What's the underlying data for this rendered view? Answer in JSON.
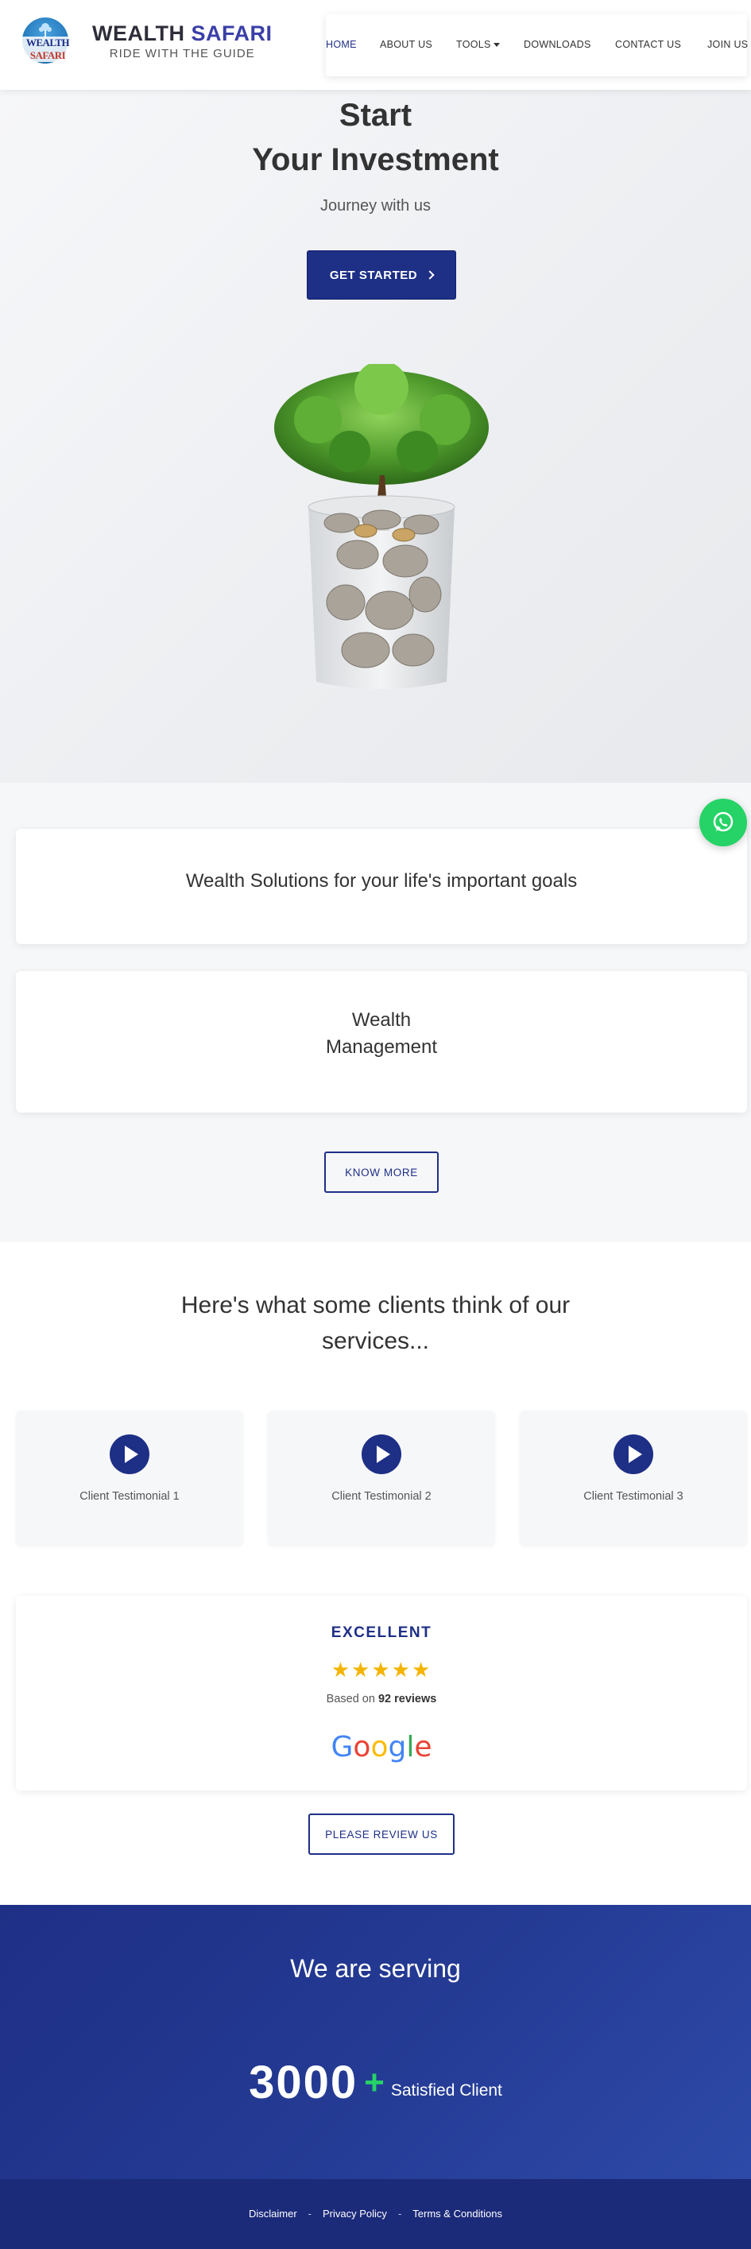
{
  "header": {
    "logo_wordmark_a": "WEALTH",
    "logo_wordmark_b": "SAFARI",
    "brand_name_a": "WEALTH",
    "brand_name_b": "SAFARI",
    "brand_tagline": "RIDE WITH THE GUIDE",
    "accent_color": "#1e2f86"
  },
  "nav": {
    "items": [
      {
        "label": "HOME",
        "active": true
      },
      {
        "label": "ABOUT US"
      },
      {
        "label": "TOOLS",
        "has_dropdown": true
      },
      {
        "label": "DOWNLOADS"
      },
      {
        "label": "CONTACT US"
      },
      {
        "label": "JOIN US"
      }
    ]
  },
  "hero": {
    "title_line1": "Start",
    "title_line2": "Your Investment",
    "subtitle": "Journey with us",
    "cta_label": "GET STARTED"
  },
  "whatsapp": {
    "icon": "whatsapp-icon",
    "color": "#25d366"
  },
  "solutions": {
    "card1_text": "Wealth Solutions for your life's important goals",
    "card2_line1": "Wealth",
    "card2_line2": "Management",
    "know_more_label": "KNOW MORE"
  },
  "testimonials": {
    "title_line1": "Here's what some clients think of our",
    "title_line2": "services...",
    "items": [
      {
        "label": "Client Testimonial 1"
      },
      {
        "label": "Client Testimonial 2"
      },
      {
        "label": "Client Testimonial 3"
      }
    ]
  },
  "review": {
    "rating_text": "EXCELLENT",
    "stars": 5,
    "based_prefix": "Based on",
    "review_count": "92 reviews",
    "provider": "Google",
    "cta_label": "PLEASE REVIEW US"
  },
  "serving": {
    "title": "We are serving",
    "count": "3000",
    "plus": "+",
    "count_label": "Satisfied Client"
  },
  "footer": {
    "links": [
      "Disclaimer",
      "Privacy Policy",
      "Terms & Conditions"
    ],
    "separator": "-"
  }
}
